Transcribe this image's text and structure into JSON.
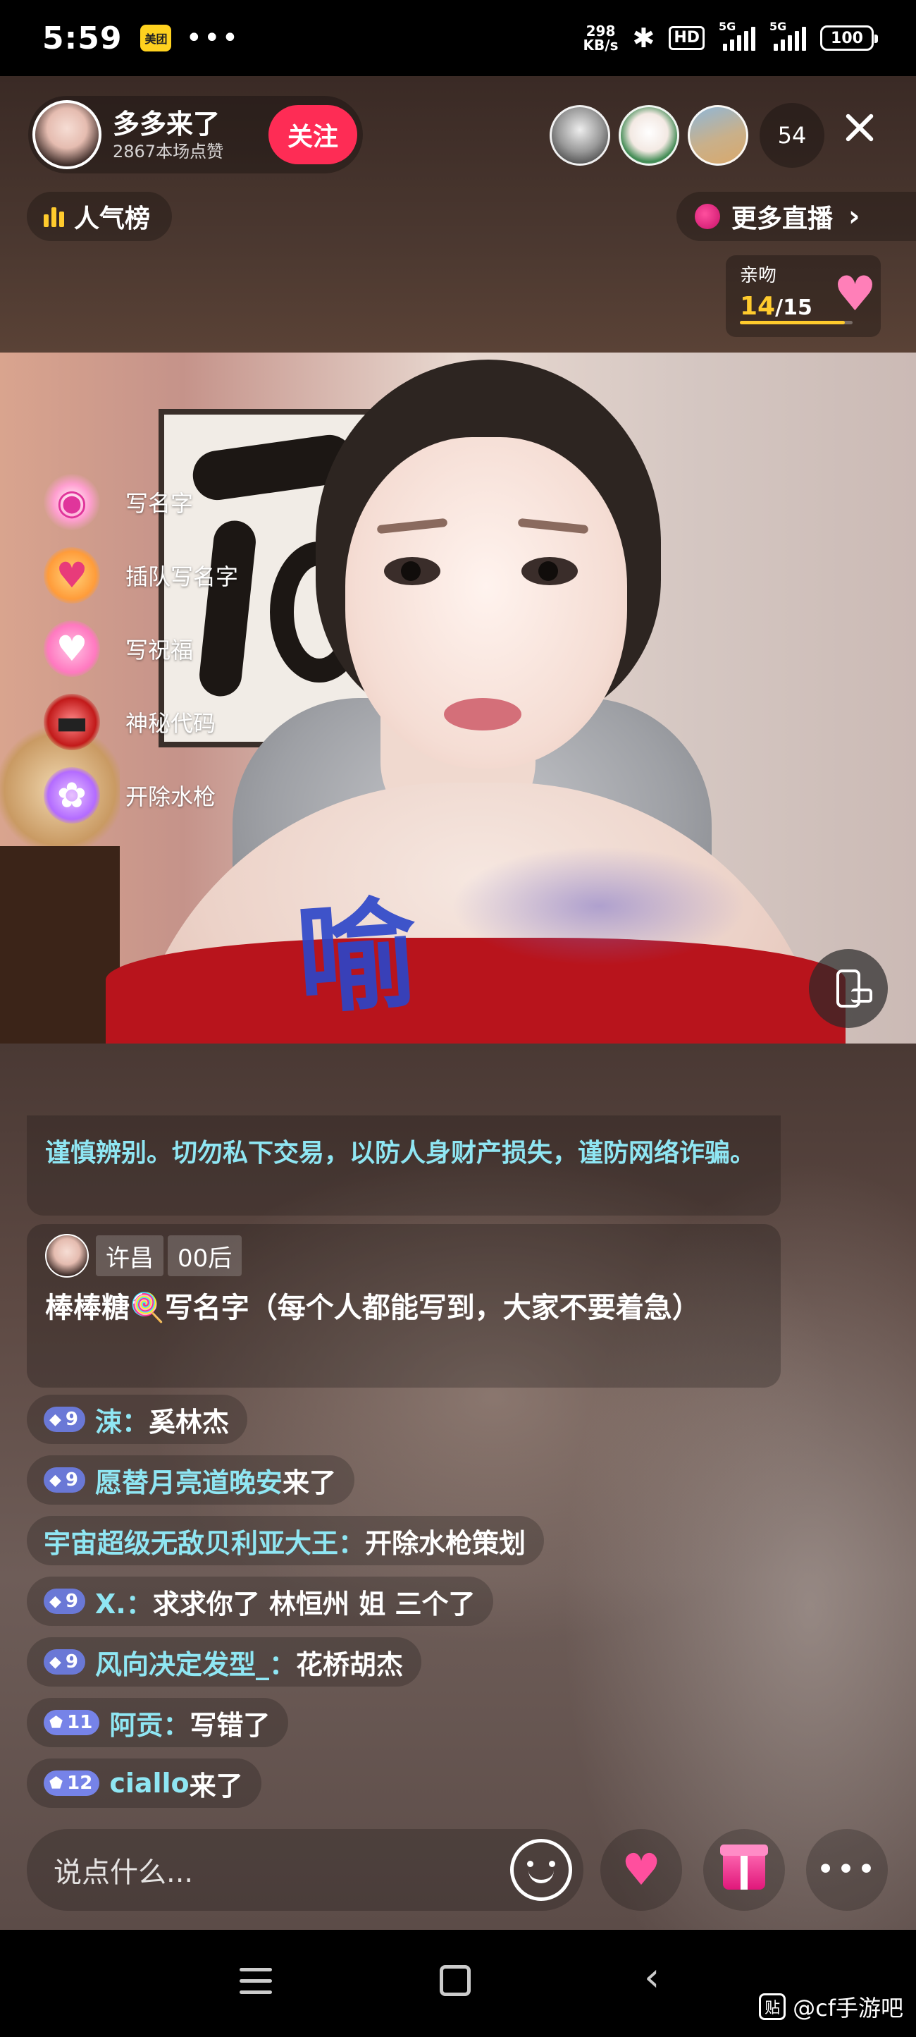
{
  "status_bar": {
    "time": "5:59",
    "app_badge": "美团",
    "more_dots": "•••",
    "net_speed_value": "298",
    "net_speed_unit": "KB/s",
    "hd_badge": "HD",
    "signal_1_label": "5G",
    "signal_2_label": "5G",
    "battery": "100"
  },
  "host": {
    "name": "多多来了",
    "likes": "2867本场点赞",
    "follow_label": "关注"
  },
  "viewers": {
    "count": "54"
  },
  "rank": {
    "label": "人气榜"
  },
  "more_live": {
    "label": "更多直播"
  },
  "kiss_goal": {
    "title": "亲吻",
    "current": "14",
    "separator": "/",
    "total": "15",
    "progress_fraction": 0.933
  },
  "side_menu": [
    {
      "label": "写名字",
      "icon": "lollipop-icon"
    },
    {
      "label": "插队写名字",
      "icon": "heart-face-icon"
    },
    {
      "label": "写祝福",
      "icon": "heart-bubble-icon"
    },
    {
      "label": "神秘代码",
      "icon": "sports-car-icon"
    },
    {
      "label": "开除水枪",
      "icon": "flower-icon"
    }
  ],
  "video": {
    "body_writing": "喻"
  },
  "chat": {
    "notice": "谨慎辨别。切勿私下交易，以防人身财产损失，谨防网络诈骗。",
    "pinned": {
      "tag1": "许昌",
      "tag2": "00后",
      "lolly_prefix": "棒棒糖",
      "lolly_icon": "🍭",
      "text": "写名字（每个人都能写到，大家不要着急）"
    },
    "messages": [
      {
        "level": "9",
        "user": "涑：",
        "text": "奚林杰"
      },
      {
        "level": "9",
        "user": "愿替月亮道晚安",
        "text": " 来了"
      },
      {
        "level": "",
        "user": "宇宙超级无敌贝利亚大王：",
        "text": "开除水枪策划"
      },
      {
        "level": "9",
        "user": "X.：",
        "text": "求求你了 林恒州 姐 三个了"
      },
      {
        "level": "9",
        "user": "风向决定发型_：",
        "text": "花桥胡杰"
      },
      {
        "level": "11",
        "user": "阿贡：",
        "text": "写错了"
      },
      {
        "level": "12",
        "user": "ciallo",
        "text": " 来了"
      }
    ]
  },
  "bottom_bar": {
    "input_placeholder": "说点什么..."
  },
  "watermark": {
    "icon": "贴",
    "text": "@cf手游吧"
  }
}
